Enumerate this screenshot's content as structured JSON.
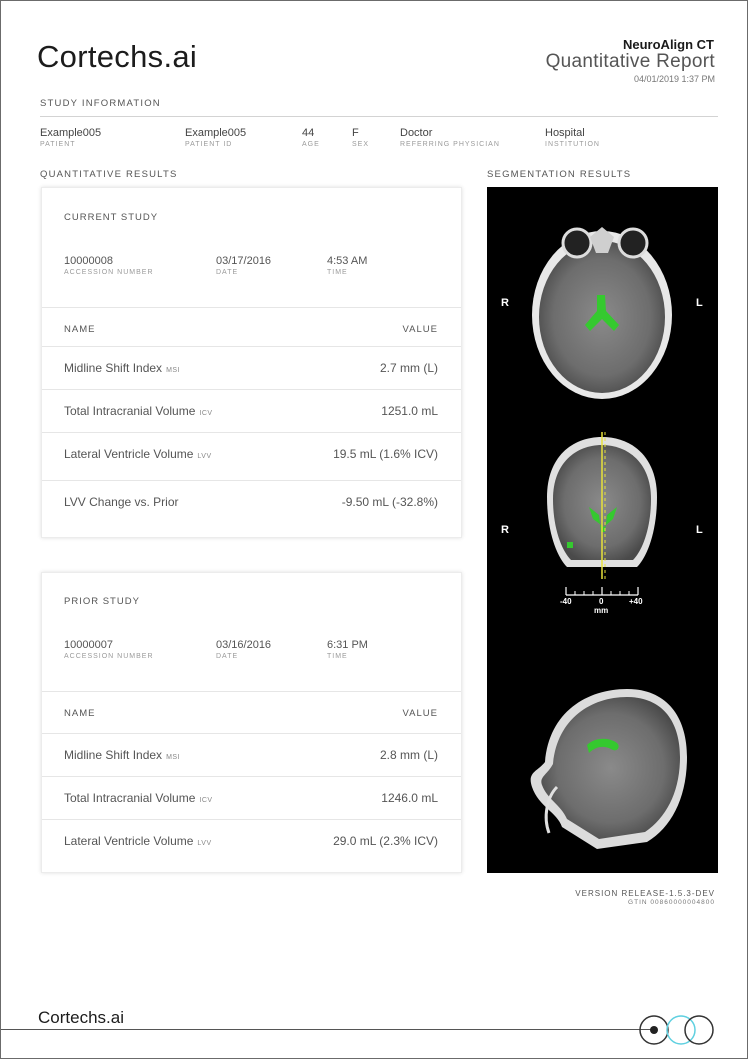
{
  "header": {
    "logo": "Cortechs.ai",
    "product": "NeuroAlign CT",
    "title": "Quantitative Report",
    "date": "04/01/2019 1:37 PM"
  },
  "study_info": {
    "title": "STUDY INFORMATION",
    "fields": [
      {
        "value": "Example005",
        "label": "PATIENT"
      },
      {
        "value": "Example005",
        "label": "PATIENT ID"
      },
      {
        "value": "44",
        "label": "AGE"
      },
      {
        "value": "F",
        "label": "SEX"
      },
      {
        "value": "Doctor",
        "label": "REFERRING PHYSICIAN"
      },
      {
        "value": "Hospital",
        "label": "INSTITUTION"
      }
    ]
  },
  "quant": {
    "title": "QUANTITATIVE RESULTS",
    "col_name": "NAME",
    "col_value": "VALUE",
    "current": {
      "title": "CURRENT STUDY",
      "accession": {
        "value": "10000008",
        "label": "ACCESSION NUMBER"
      },
      "date": {
        "value": "03/17/2016",
        "label": "DATE"
      },
      "time": {
        "value": "4:53 AM",
        "label": "TIME"
      },
      "rows": [
        {
          "name": "Midline Shift Index",
          "abbr": "MSI",
          "value": "2.7 mm (L)"
        },
        {
          "name": "Total Intracranial Volume",
          "abbr": "ICV",
          "value": "1251.0 mL"
        },
        {
          "name": "Lateral Ventricle Volume",
          "abbr": "LVV",
          "value": "19.5 mL (1.6% ICV)"
        },
        {
          "name": "LVV Change vs. Prior",
          "abbr": "",
          "value": "-9.50 mL (-32.8%)"
        }
      ]
    },
    "prior": {
      "title": "PRIOR STUDY",
      "accession": {
        "value": "10000007",
        "label": "ACCESSION NUMBER"
      },
      "date": {
        "value": "03/16/2016",
        "label": "DATE"
      },
      "time": {
        "value": "6:31 PM",
        "label": "TIME"
      },
      "rows": [
        {
          "name": "Midline Shift Index",
          "abbr": "MSI",
          "value": "2.8 mm (L)"
        },
        {
          "name": "Total Intracranial Volume",
          "abbr": "ICV",
          "value": "1246.0 mL"
        },
        {
          "name": "Lateral Ventricle Volume",
          "abbr": "LVV",
          "value": "29.0 mL (2.3% ICV)"
        }
      ]
    }
  },
  "segmentation": {
    "title": "SEGMENTATION RESULTS",
    "left_marker": "R",
    "right_marker": "L",
    "scale": {
      "min": "-40",
      "mid": "0",
      "max": "+40",
      "unit": "mm"
    },
    "highlight_color": "#35c92f",
    "midline_color": "#e8e23a"
  },
  "footer": {
    "version": "VERSION RELEASE-1.5.3-DEV",
    "gtin": "GTIN 00860000004800",
    "logo": "Cortechs.ai"
  }
}
